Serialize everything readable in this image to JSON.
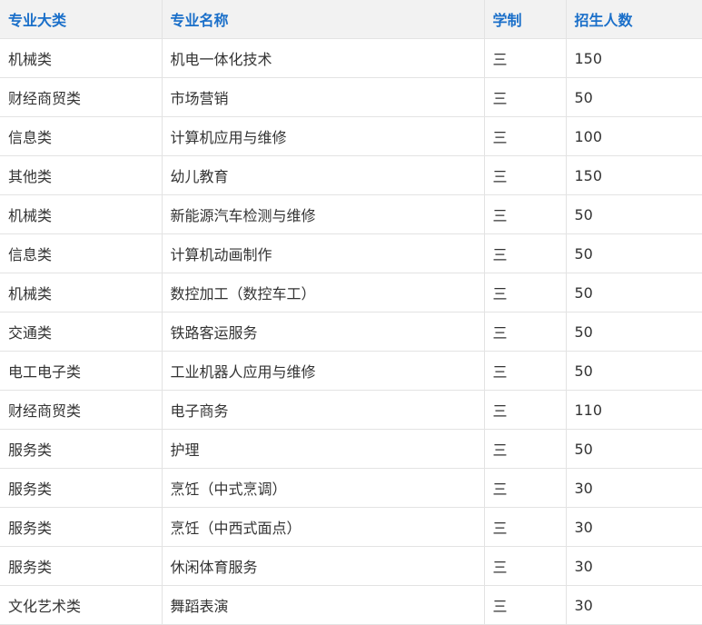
{
  "table": {
    "headers": [
      "专业大类",
      "专业名称",
      "学制",
      "招生人数"
    ],
    "rows": [
      [
        "机械类",
        "机电一体化技术",
        "三",
        "150"
      ],
      [
        "财经商贸类",
        "市场营销",
        "三",
        "50"
      ],
      [
        "信息类",
        "计算机应用与维修",
        "三",
        "100"
      ],
      [
        "其他类",
        "幼儿教育",
        "三",
        "150"
      ],
      [
        "机械类",
        "新能源汽车检测与维修",
        "三",
        "50"
      ],
      [
        "信息类",
        "计算机动画制作",
        "三",
        "50"
      ],
      [
        "机械类",
        "数控加工（数控车工）",
        "三",
        "50"
      ],
      [
        "交通类",
        "铁路客运服务",
        "三",
        "50"
      ],
      [
        "电工电子类",
        "工业机器人应用与维修",
        "三",
        "50"
      ],
      [
        "财经商贸类",
        "电子商务",
        "三",
        "110"
      ],
      [
        "服务类",
        "护理",
        "三",
        "50"
      ],
      [
        "服务类",
        "烹饪（中式烹调）",
        "三",
        "30"
      ],
      [
        "服务类",
        "烹饪（中西式面点）",
        "三",
        "30"
      ],
      [
        "服务类",
        "休闲体育服务",
        "三",
        "30"
      ],
      [
        "文化艺术类",
        "舞蹈表演",
        "三",
        "30"
      ]
    ]
  },
  "colors": {
    "header_text": "#1a6fc9",
    "header_bg": "#f2f2f2",
    "body_text": "#333333",
    "border": "#e3e3e3"
  }
}
